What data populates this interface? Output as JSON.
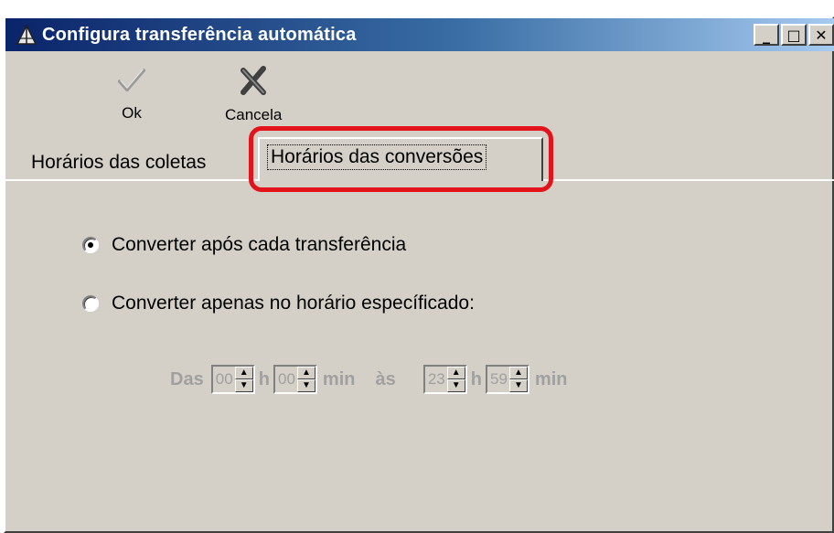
{
  "window": {
    "title": "Configura transferência automática",
    "controls": {
      "minimize": "_",
      "maximize": "□",
      "close": "✕"
    }
  },
  "toolbar": {
    "ok_label": "Ok",
    "ok_icon": "checkmark-icon",
    "cancel_label": "Cancela",
    "cancel_icon": "cancel-x-icon"
  },
  "tabs": [
    {
      "label": "Horários das coletas",
      "active": false
    },
    {
      "label": "Horários das conversões",
      "active": true
    }
  ],
  "options": {
    "after_each": {
      "label": "Converter após cada transferência",
      "selected": true
    },
    "specific_time": {
      "label": "Converter apenas no horário específicado:",
      "selected": false
    }
  },
  "time_range": {
    "from_label": "Das",
    "from_hour": "00",
    "h_label": "h",
    "from_min": "00",
    "min_label": "min",
    "to_label": "às",
    "to_hour": "23",
    "to_min": "59"
  },
  "colors": {
    "highlight": "#e3131b",
    "title_start": "#0a246a",
    "title_end": "#a6caf0"
  }
}
